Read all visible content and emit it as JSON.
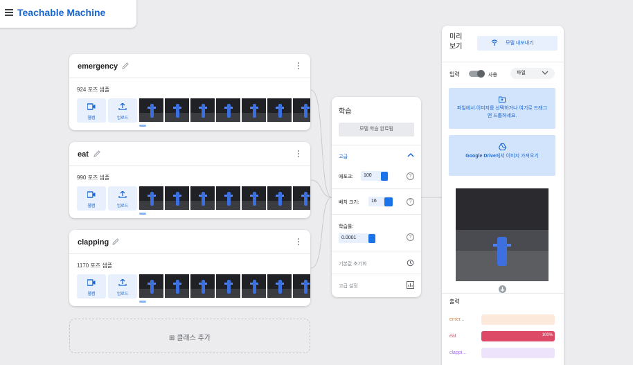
{
  "app": {
    "title": "Teachable Machine"
  },
  "colors": {
    "accent": "#1967d2",
    "accent_light": "#e8f0fe",
    "drop_bg": "#d2e3fc"
  },
  "classes": [
    {
      "name": "emergency",
      "sample_count": "924 포즈 샘플",
      "webcam_label": "웹캠",
      "upload_label": "업로드"
    },
    {
      "name": "eat",
      "sample_count": "990 포즈 샘플",
      "webcam_label": "웹캠",
      "upload_label": "업로드"
    },
    {
      "name": "clapping",
      "sample_count": "1170 포즈 샘플",
      "webcam_label": "웹캠",
      "upload_label": "업로드"
    }
  ],
  "add_class_label": "⊞ 클래스 추가",
  "training": {
    "title": "학습",
    "train_button": "모델 학습 완료됨",
    "advanced_label": "고급",
    "epochs_label": "에포크:",
    "epochs_value": "100",
    "batch_label": "배치 크기:",
    "batch_value": "16",
    "lr_label": "학습률:",
    "lr_value": "0.0001",
    "reset_label": "기본값 초기화",
    "under_hood_label": "고급 설정",
    "help_glyph": "?"
  },
  "preview": {
    "title": "미리 보기",
    "export_label": "모델 내보내기",
    "input_label": "입력",
    "toggle_label": "사용",
    "source_select": "파일",
    "file_drop_text": "파일에서 이미지를 선택하거나 여기로 드래그 앤 드롭하세요.",
    "drive_text_bold": "Google Drive",
    "drive_text_rest": "에서 이미지 가져오기",
    "output_label": "출력",
    "outputs": [
      {
        "label": "emer...",
        "percent": 0,
        "percent_text": "",
        "color": "#f57c28",
        "bg": "#fde9dc"
      },
      {
        "label": "eat",
        "percent": 100,
        "percent_text": "100%",
        "color": "#dc4a68",
        "bg": "#f8dde3"
      },
      {
        "label": "clappi...",
        "percent": 0,
        "percent_text": "",
        "color": "#a36ee6",
        "bg": "#ede4fb"
      }
    ]
  }
}
